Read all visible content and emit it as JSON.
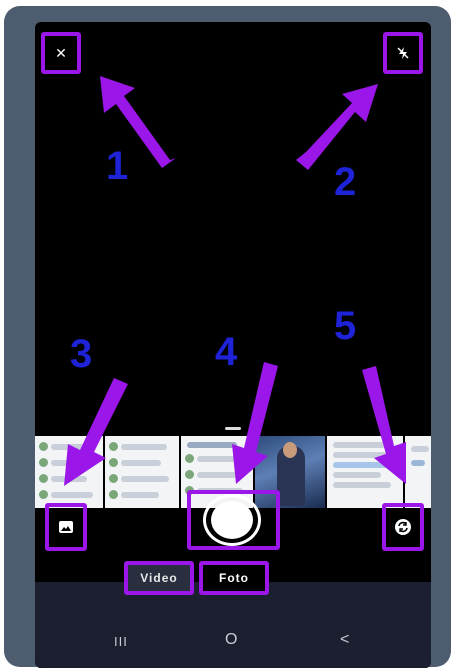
{
  "camera": {
    "close_icon": "close-icon",
    "flash_icon": "flash-off-icon",
    "gallery_icon": "gallery-icon",
    "switch_camera_icon": "switch-camera-icon",
    "shutter_icon": "shutter-button"
  },
  "modes": [
    {
      "label": "Video",
      "active": false
    },
    {
      "label": "Foto",
      "active": true
    }
  ],
  "nav": {
    "recent_glyph": "III",
    "home_glyph": "O",
    "back_glyph": "<"
  },
  "annotations": [
    "1",
    "2",
    "3",
    "4",
    "5"
  ],
  "colors": {
    "highlight": "#9b16e8",
    "number": "#1e23d8",
    "frame": "#4e5c70"
  }
}
